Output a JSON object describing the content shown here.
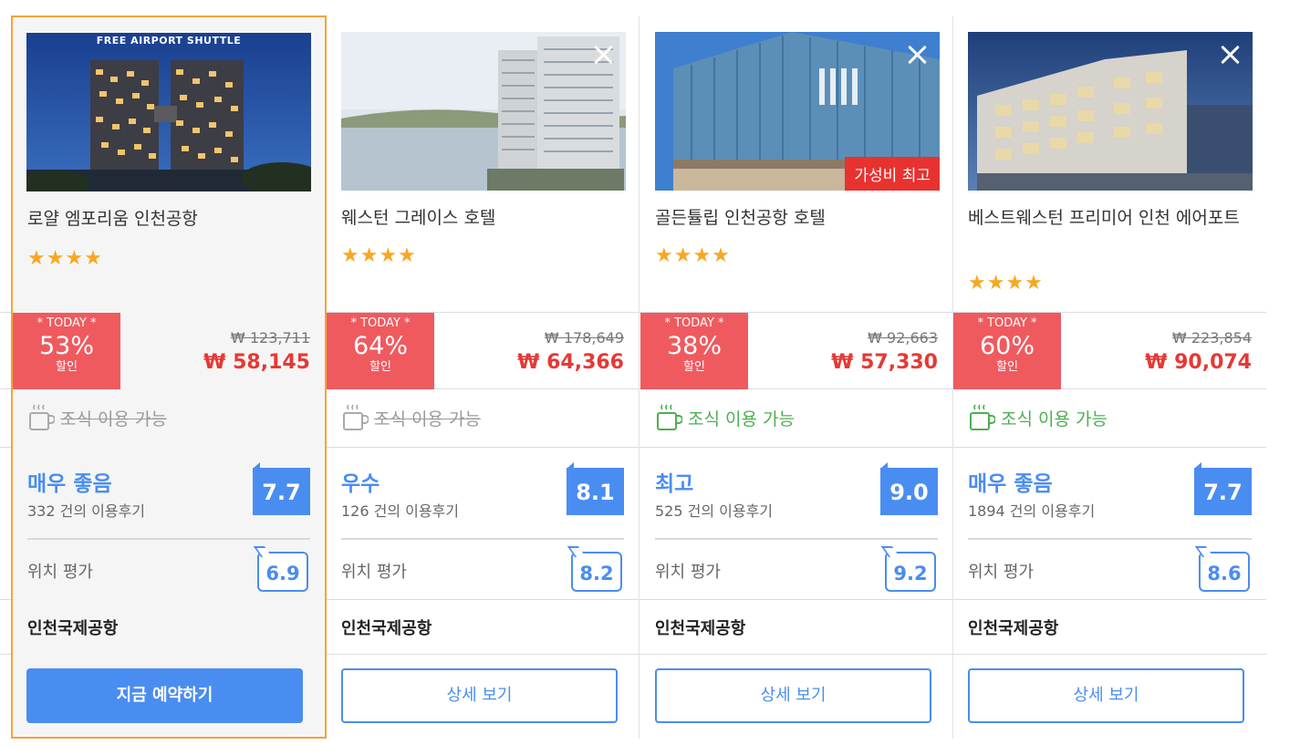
{
  "hotels": [
    {
      "name": "로얄 엠포리움 인천공항",
      "stars": "★★★★",
      "photo_caption": "FREE AIRPORT SHUTTLE",
      "deal": {
        "today": "* TODAY *",
        "percent": "53%",
        "unit": "할인",
        "original": "₩ 123,711",
        "final": "₩ 58,145"
      },
      "breakfast": "조식 이용 가능",
      "breakfast_available": false,
      "rating": {
        "word": "매우 좋음",
        "reviews": "332 건의 이용후기",
        "score": "7.7"
      },
      "location": {
        "label": "위치 평가",
        "score": "6.9"
      },
      "area": "인천국제공항",
      "button": "지금 예약하기"
    },
    {
      "name": "웨스턴 그레이스 호텔",
      "stars": "★★★★",
      "deal": {
        "today": "* TODAY *",
        "percent": "64%",
        "unit": "할인",
        "original": "₩ 178,649",
        "final": "₩ 64,366"
      },
      "breakfast": "조식 이용 가능",
      "breakfast_available": false,
      "rating": {
        "word": "우수",
        "reviews": "126 건의 이용후기",
        "score": "8.1"
      },
      "location": {
        "label": "위치 평가",
        "score": "8.2"
      },
      "area": "인천국제공항",
      "button": "상세 보기"
    },
    {
      "name": "골든튤립 인천공항 호텔",
      "stars": "★★★★",
      "value_badge": "가성비 최고",
      "deal": {
        "today": "* TODAY *",
        "percent": "38%",
        "unit": "할인",
        "original": "₩ 92,663",
        "final": "₩ 57,330"
      },
      "breakfast": "조식 이용 가능",
      "breakfast_available": true,
      "rating": {
        "word": "최고",
        "reviews": "525 건의 이용후기",
        "score": "9.0"
      },
      "location": {
        "label": "위치 평가",
        "score": "9.2"
      },
      "area": "인천국제공항",
      "button": "상세 보기"
    },
    {
      "name": "베스트웨스턴 프리미어 인천 에어포트",
      "stars": "★★★★",
      "deal": {
        "today": "* TODAY *",
        "percent": "60%",
        "unit": "할인",
        "original": "₩ 223,854",
        "final": "₩ 90,074"
      },
      "breakfast": "조식 이용 가능",
      "breakfast_available": true,
      "rating": {
        "word": "매우 좋음",
        "reviews": "1894 건의 이용후기",
        "score": "7.7"
      },
      "location": {
        "label": "위치 평가",
        "score": "8.6"
      },
      "area": "인천국제공항",
      "button": "상세 보기"
    }
  ],
  "colors": {
    "accent": "#4a8df0",
    "deal": "#ef5a5f",
    "price": "#e53935",
    "selected_border": "#f5a33a",
    "star": "#f7a823",
    "breakfast_on": "#4caf50"
  }
}
